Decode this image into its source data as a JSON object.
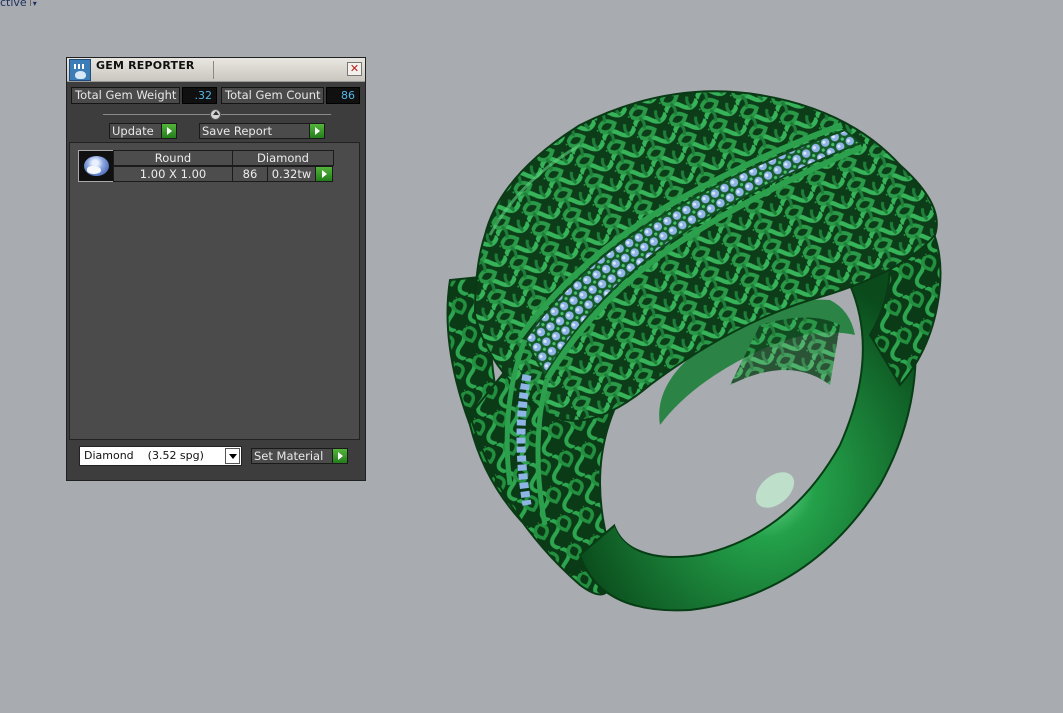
{
  "viewport": {
    "corner_label": "ctive",
    "background": "#a8acb0"
  },
  "panel": {
    "title": "GEM REPORTER",
    "close_icon": "close-icon",
    "total_gem_weight_label": "Total Gem Weight",
    "total_gem_weight_value": ".32",
    "total_gem_count_label": "Total Gem Count",
    "total_gem_count_value": "86",
    "update_label": "Update",
    "save_report_label": "Save Report",
    "gems": [
      {
        "shape": "Round",
        "material": "Diamond",
        "size": "1.00 X 1.00",
        "count": "86",
        "weight": "0.32tw",
        "icon": "round-gem-icon"
      }
    ],
    "material_select_value": "Diamond    (3.52 spg)",
    "set_material_label": "Set Material",
    "accent_color": "#3a9a2a",
    "value_color": "#56b6e6"
  }
}
